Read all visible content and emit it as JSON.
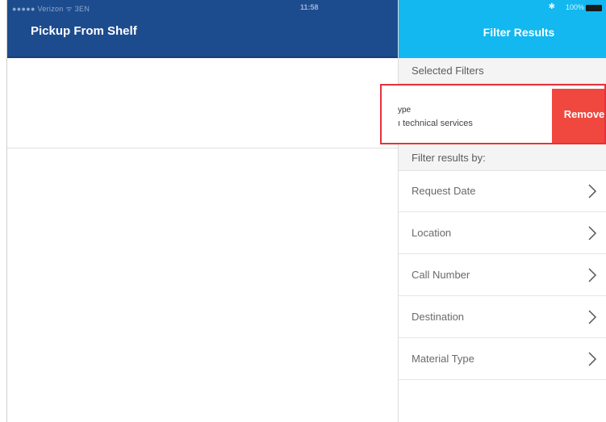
{
  "left": {
    "status": {
      "carrier": "●●●●● Verizon ᯤ 3EN",
      "time": "11:58"
    },
    "title": "Pickup From Shelf"
  },
  "right": {
    "status": {
      "battery_text": "100%"
    },
    "title": "Filter Results",
    "selected_header": "Selected Filters",
    "selected_filter": {
      "title": "ype",
      "value": "ı technical services",
      "remove_label": "Remove"
    },
    "filter_by_header": "Filter results by:",
    "filters": [
      {
        "label": "Request Date"
      },
      {
        "label": "Location"
      },
      {
        "label": "Call Number"
      },
      {
        "label": "Destination"
      },
      {
        "label": "Material Type"
      }
    ]
  },
  "colors": {
    "left_nav": "#1d4c8e",
    "right_nav": "#12b8ef",
    "remove": "#f0473f",
    "highlight_border": "#e6323c"
  },
  "icons": [
    "chevron-right-icon",
    "bluetooth-icon",
    "battery-icon",
    "wifi-icon"
  ]
}
